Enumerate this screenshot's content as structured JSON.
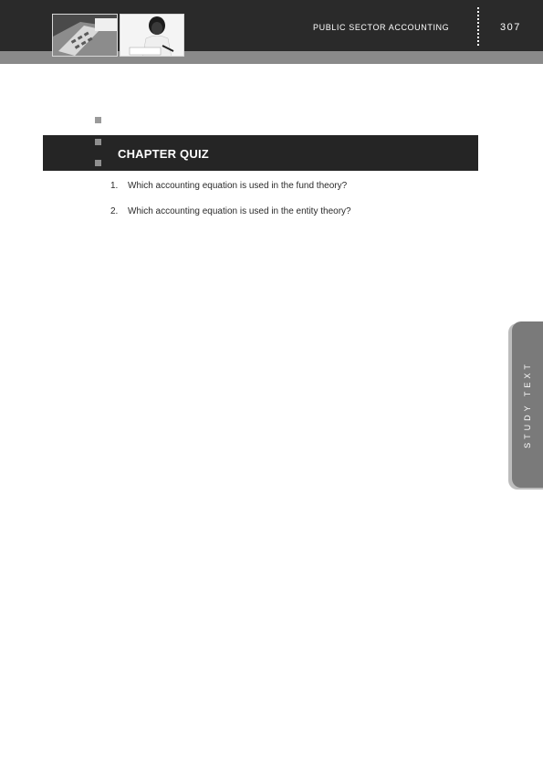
{
  "header": {
    "title": "PUBLIC SECTOR ACCOUNTING",
    "page_number": "307",
    "photos": [
      "calculator-photo",
      "person-writing-photo"
    ]
  },
  "section": {
    "title": "CHAPTER QUIZ"
  },
  "questions": [
    {
      "number": "1.",
      "text": "Which accounting equation is used in the fund theory?"
    },
    {
      "number": "2.",
      "text": "Which accounting equation is used in the entity theory?"
    }
  ],
  "side_tab": {
    "label": "STUDY TEXT"
  },
  "colors": {
    "header_bg": "#2a2a2a",
    "strip": "#8a8a8a",
    "quiz_bar": "#252525",
    "side_tab": "#7a7a7a"
  }
}
